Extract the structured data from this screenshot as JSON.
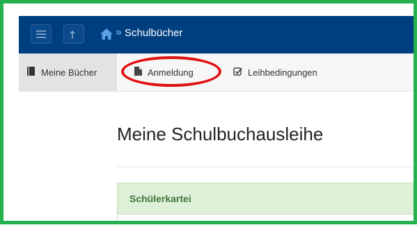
{
  "topbar": {
    "menu_icon": "hamburger-icon",
    "up_icon": "arrow-up-icon",
    "home_icon": "home-icon",
    "breadcrumb_separator": "»",
    "breadcrumb_title": "Schulbücher"
  },
  "tabs": [
    {
      "label": "Meine Bücher",
      "icon": "book-icon",
      "active": true
    },
    {
      "label": "Anmeldung",
      "icon": "file-icon",
      "active": false
    },
    {
      "label": "Leihbedingungen",
      "icon": "checkbox-icon",
      "active": false
    }
  ],
  "main": {
    "title": "Meine Schulbuchausleihe",
    "panel_title": "Schülerkartei"
  },
  "colors": {
    "topbar": "#003f7f",
    "annotation_circle": "#e01010",
    "frame_border": "#22b14c",
    "panel_header": "#dff0d8"
  }
}
